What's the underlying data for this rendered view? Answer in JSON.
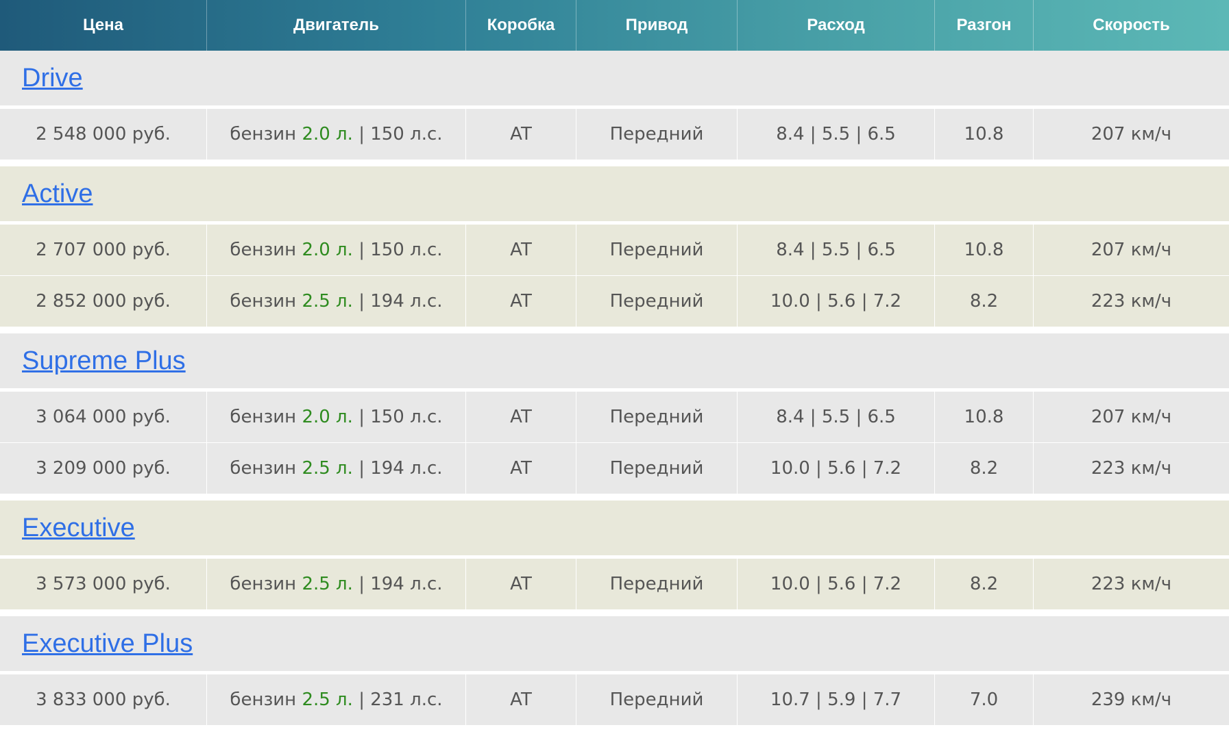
{
  "headers": [
    "Цена",
    "Двигатель",
    "Коробка",
    "Привод",
    "Расход",
    "Разгон",
    "Скорость"
  ],
  "colors": {
    "header_start": "#1f5a7a",
    "header_end": "#5cb8b6",
    "link": "#2f6fe6",
    "volume": "#2e8b1f",
    "row_gray": "#e8e8e8",
    "row_beige": "#e8e8da"
  },
  "groups": [
    {
      "name": "Drive",
      "shade": "gray",
      "rows": [
        {
          "price": "2 548 000 руб.",
          "fuel": "бензин ",
          "volume": "2.0 л.",
          "power": " | 150 л.с.",
          "gearbox": "AT",
          "drive": "Передний",
          "consumption": "8.4 | 5.5 | 6.5",
          "accel": "10.8",
          "speed": "207 км/ч"
        }
      ]
    },
    {
      "name": "Active",
      "shade": "beige",
      "rows": [
        {
          "price": "2 707 000 руб.",
          "fuel": "бензин ",
          "volume": "2.0 л.",
          "power": " | 150 л.с.",
          "gearbox": "AT",
          "drive": "Передний",
          "consumption": "8.4 | 5.5 | 6.5",
          "accel": "10.8",
          "speed": "207 км/ч"
        },
        {
          "price": "2 852 000 руб.",
          "fuel": "бензин ",
          "volume": "2.5 л.",
          "power": " | 194 л.с.",
          "gearbox": "AT",
          "drive": "Передний",
          "consumption": "10.0 | 5.6 | 7.2",
          "accel": "8.2",
          "speed": "223 км/ч"
        }
      ]
    },
    {
      "name": "Supreme Plus",
      "shade": "gray",
      "rows": [
        {
          "price": "3 064 000 руб.",
          "fuel": "бензин ",
          "volume": "2.0 л.",
          "power": " | 150 л.с.",
          "gearbox": "AT",
          "drive": "Передний",
          "consumption": "8.4 | 5.5 | 6.5",
          "accel": "10.8",
          "speed": "207 км/ч"
        },
        {
          "price": "3 209 000 руб.",
          "fuel": "бензин ",
          "volume": "2.5 л.",
          "power": " | 194 л.с.",
          "gearbox": "AT",
          "drive": "Передний",
          "consumption": "10.0 | 5.6 | 7.2",
          "accel": "8.2",
          "speed": "223 км/ч"
        }
      ]
    },
    {
      "name": "Executive",
      "shade": "beige",
      "rows": [
        {
          "price": "3 573 000 руб.",
          "fuel": "бензин ",
          "volume": "2.5 л.",
          "power": " | 194 л.с.",
          "gearbox": "AT",
          "drive": "Передний",
          "consumption": "10.0 | 5.6 | 7.2",
          "accel": "8.2",
          "speed": "223 км/ч"
        }
      ]
    },
    {
      "name": "Executive Plus",
      "shade": "gray",
      "rows": [
        {
          "price": "3 833 000 руб.",
          "fuel": "бензин ",
          "volume": "2.5 л.",
          "power": " | 231 л.с.",
          "gearbox": "AT",
          "drive": "Передний",
          "consumption": "10.7 | 5.9 | 7.7",
          "accel": "7.0",
          "speed": "239 км/ч"
        }
      ]
    }
  ]
}
